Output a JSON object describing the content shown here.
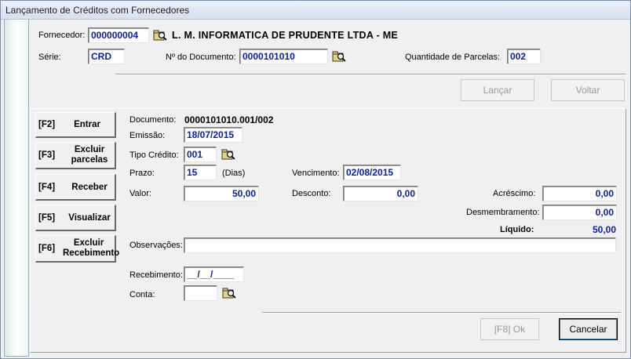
{
  "window": {
    "title": "Lançamento de Créditos com Fornecedores"
  },
  "header": {
    "fornecedor_label": "Fornecedor:",
    "fornecedor_code": "000000004",
    "fornecedor_name": "L. M. INFORMATICA DE PRUDENTE LTDA - ME",
    "serie_label": "Série:",
    "serie_value": "CRD",
    "documento_label": "Nº do Documento:",
    "documento_value": "0000101010",
    "parcelas_label": "Quantidade de Parcelas:",
    "parcelas_value": "002"
  },
  "top_buttons": {
    "lancar": "Lançar",
    "voltar": "Voltar"
  },
  "side_buttons": [
    {
      "key": "[F2]",
      "label": "Entrar"
    },
    {
      "key": "[F3]",
      "label": "Excluir parcelas"
    },
    {
      "key": "[F4]",
      "label": "Receber"
    },
    {
      "key": "[F5]",
      "label": "Visualizar"
    },
    {
      "key": "[F6]",
      "label": "Excluir Recebimento"
    }
  ],
  "detail": {
    "documento_label": "Documento:",
    "documento_value": "0000101010.001/002",
    "emissao_label": "Emissão:",
    "emissao_value": "18/07/2015",
    "tipo_credito_label": "Tipo Crédito:",
    "tipo_credito_value": "001",
    "prazo_label": "Prazo:",
    "prazo_value": "15",
    "prazo_unit": "(Dias)",
    "vencimento_label": "Vencimento:",
    "vencimento_value": "02/08/2015",
    "valor_label": "Valor:",
    "valor_value": "50,00",
    "desconto_label": "Desconto:",
    "desconto_value": "0,00",
    "acrescimo_label": "Acréscimo:",
    "acrescimo_value": "0,00",
    "desmembramento_label": "Desmembramento:",
    "desmembramento_value": "0,00",
    "liquido_label": "Líquido:",
    "liquido_value": "50,00",
    "observacoes_label": "Observações:",
    "observacoes_value": "",
    "recebimento_label": "Recebimento:",
    "recebimento_value": "__/__/____",
    "conta_label": "Conta:",
    "conta_value": ""
  },
  "bottom_buttons": {
    "ok": "[F8]   Ok",
    "cancelar": "Cancelar"
  },
  "icons": {
    "lookup": "folder-search-icon"
  },
  "colors": {
    "value_text": "#0a1fa0",
    "title_bar": "#dce6f0"
  }
}
